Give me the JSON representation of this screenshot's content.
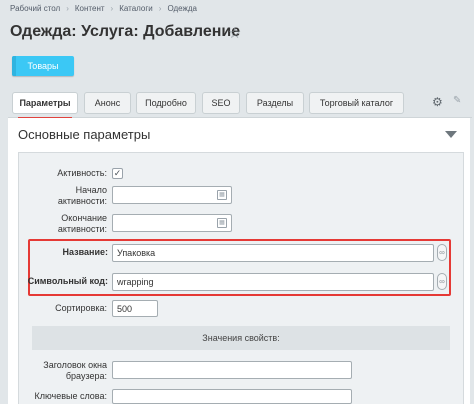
{
  "breadcrumbs": [
    "Рабочий стол",
    "Контент",
    "Каталоги",
    "Одежда"
  ],
  "page": {
    "title": "Одежда: Услуга: Добавление"
  },
  "goods_button": "Товары",
  "tabs": [
    "Параметры",
    "Анонс",
    "Подробно",
    "SEO",
    "Разделы",
    "Торговый каталог"
  ],
  "section_title": "Основные параметры",
  "form": {
    "active_label": "Активность:",
    "active_checked": true,
    "start_label_1": "Начало",
    "start_label_2": "активности:",
    "end_label_1": "Окончание",
    "end_label_2": "активности:",
    "name_label": "Название:",
    "name_value": "Упаковка",
    "code_label": "Символьный код:",
    "code_value": "wrapping",
    "sort_label": "Сортировка:",
    "sort_value": "500",
    "props_header": "Значения свойств:",
    "browser_title_label_1": "Заголовок окна",
    "browser_title_label_2": "браузера:",
    "keywords_label": "Ключевые слова:"
  }
}
